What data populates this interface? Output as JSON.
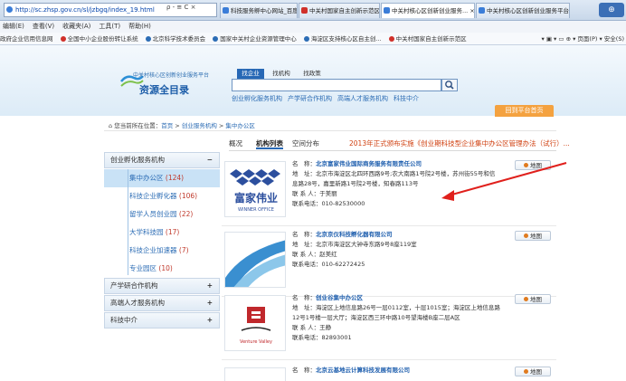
{
  "browser": {
    "url": "http://sc.zhsp.gov.cn/sl/jzbgq/index_19.html",
    "addr_tools": "ρ - ≅ C ×",
    "tabs": [
      {
        "label": "科技服务孵中心网站_百度搜索",
        "active": false,
        "color": "#3b7dd8"
      },
      {
        "label": "中关村国家自主创新示范区",
        "active": false,
        "color": "#d0302a"
      },
      {
        "label": "中关村核心区创新创业服务...",
        "active": true,
        "color": "#3b7dd8"
      },
      {
        "label": "中关村核心区创新创业服务平台",
        "active": false,
        "color": "#3b7dd8"
      }
    ],
    "menu": [
      "编辑(E)",
      "查看(V)",
      "收藏夹(A)",
      "工具(T)",
      "帮助(H)"
    ],
    "favorites": [
      {
        "label": "政府企业信用信息网",
        "color": "#2b6cb5"
      },
      {
        "label": "全国中小企业股份转让系统",
        "color": "#d0302a"
      },
      {
        "label": "北京科学技术委员会",
        "color": "#2b6cb5"
      },
      {
        "label": "国家中关村企业资源管理中心",
        "color": "#2b6cb5"
      },
      {
        "label": "海淀区支持核心区自主创...",
        "color": "#2b6cb5"
      },
      {
        "label": "中关村国家自主创新示范区",
        "color": "#d0302a"
      }
    ],
    "cmdbar": "▾ ▣ ▾ ▭ ⊕ ▾ 页面(P) ▾ 安全(S)"
  },
  "header": {
    "logo_sub": "中关村核心区创新创业服务平台",
    "logo_main": "资源全目录",
    "search_tabs": [
      "找企业",
      "找机构",
      "找政策"
    ],
    "hot_links": [
      "创业孵化服务机构",
      "产学研合作机构",
      "高端人才服务机构",
      "科技中介"
    ],
    "return_label": "回到平台首页"
  },
  "breadcrumb": {
    "prefix": "您当前所在位置：",
    "home": "首页",
    "sep1": " > ",
    "level1": "创业服务机构",
    "sep2": " > ",
    "level2": "集中办公区"
  },
  "sidebar": {
    "categories": [
      {
        "label": "创业孵化服务机构",
        "toggle": "−"
      },
      {
        "label": "产学研合作机构",
        "toggle": "+"
      },
      {
        "label": "高端人才服务机构",
        "toggle": "+"
      },
      {
        "label": "科技中介",
        "toggle": "+"
      }
    ],
    "subitems": [
      {
        "label": "集中办公区",
        "count": "(124)",
        "active": true
      },
      {
        "label": "科技企业孵化器",
        "count": "(106)",
        "active": false
      },
      {
        "label": "留学人员创业园",
        "count": "(22)",
        "active": false
      },
      {
        "label": "大学科技园",
        "count": "(17)",
        "active": false
      },
      {
        "label": "科技企业加速器",
        "count": "(7)",
        "active": false
      },
      {
        "label": "专业园区",
        "count": "(10)",
        "active": false
      }
    ]
  },
  "content": {
    "tabs": [
      "概况",
      "机构列表",
      "空间分布"
    ],
    "notice": "2013年正式颁布实施《创业期科技型企业集中办公区管理办法（试行）...",
    "map_label": "地图",
    "labels": {
      "name": "名　称：",
      "addr": "地　址：",
      "contact": "联 系 人：",
      "phone": "联系电话："
    },
    "items": [
      {
        "name": "北京富家伟业国际商务服务有限责任公司",
        "address": "北京市海淀区北四环西路9号;农大南路1号院2号楼，苏州街55号和信息路28号，嘉里新路1号院2号楼，知春路113号",
        "contact": "于美丽",
        "phone": "010-82530000",
        "logo_text": "富家伟业",
        "logo_sub": "WINNER OFFICE"
      },
      {
        "name": "北京京仪科技孵化器有限公司",
        "address": "北京市海淀区大钟寺东路9号8座119室",
        "contact": "赵美红",
        "phone": "010-62272425",
        "logo_text": "",
        "logo_sub": ""
      },
      {
        "name": "创业谷集中办公区",
        "address": "海淀区上地信息路26号一层0112室，十层1015室；海淀区上地信息路12号1号楼一层大厅；海淀区西三环中路10号望海楼B座二层A区",
        "contact": "王静",
        "phone": "82893001",
        "logo_text": "",
        "logo_sub": "Venture Valley"
      },
      {
        "name": "北京云基地云计算科技发展有限公司",
        "address": "",
        "contact": "",
        "phone": "",
        "logo_text": "",
        "logo_sub": ""
      }
    ]
  }
}
